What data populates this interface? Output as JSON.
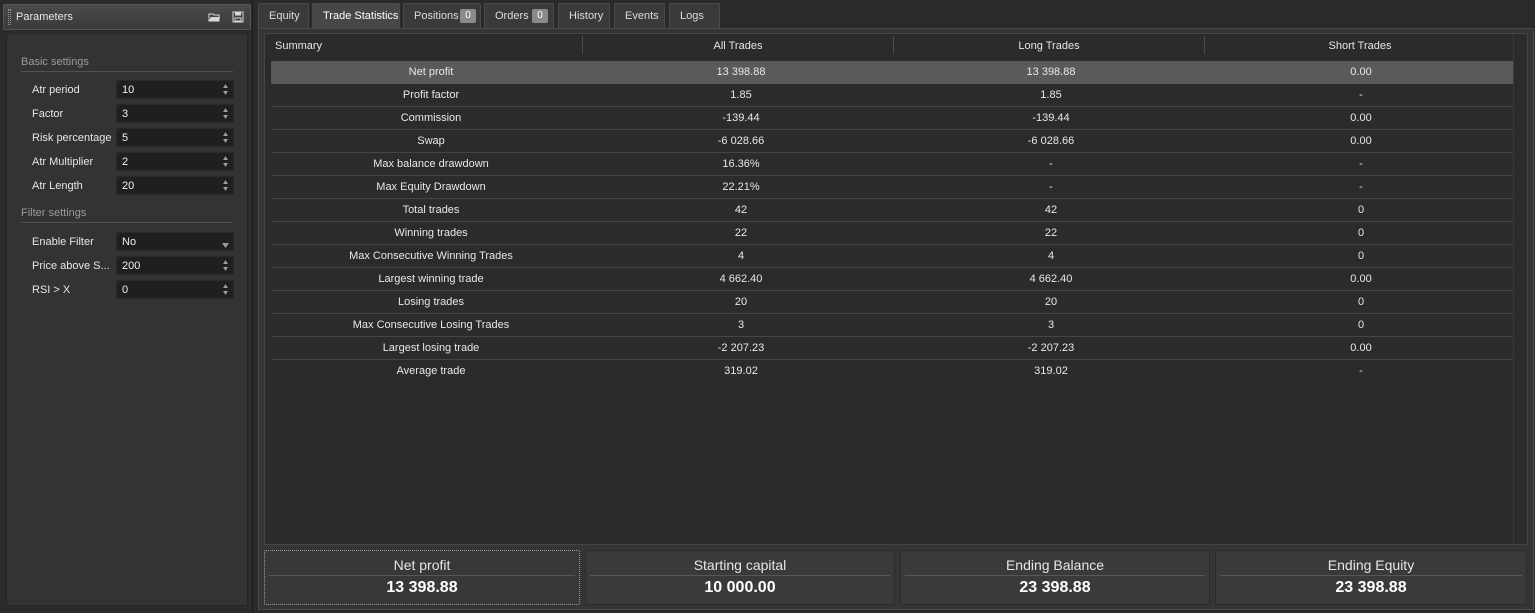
{
  "parameters_panel": {
    "title": "Parameters",
    "sections": [
      {
        "title": "Basic settings",
        "params": [
          {
            "label": "Atr period",
            "value": "10",
            "control": "spinner"
          },
          {
            "label": "Factor",
            "value": "3",
            "control": "spinner"
          },
          {
            "label": "Risk percentage",
            "value": "5",
            "control": "spinner"
          },
          {
            "label": "Atr Multiplier",
            "value": "2",
            "control": "spinner"
          },
          {
            "label": "Atr Length",
            "value": "20",
            "control": "spinner"
          }
        ]
      },
      {
        "title": "Filter settings",
        "params": [
          {
            "label": "Enable Filter",
            "value": "No",
            "control": "dropdown"
          },
          {
            "label": "Price above S...",
            "value": "200",
            "control": "spinner"
          },
          {
            "label": "RSI > X",
            "value": "0",
            "control": "spinner"
          }
        ]
      }
    ],
    "icons": [
      "folder-open-icon",
      "save-icon"
    ]
  },
  "tabs": [
    {
      "label": "Equity",
      "active": false
    },
    {
      "label": "Trade Statistics",
      "active": true
    },
    {
      "label": "Positions",
      "badge": "0",
      "active": false
    },
    {
      "label": "Orders",
      "badge": "0",
      "active": false
    },
    {
      "label": "History",
      "active": false
    },
    {
      "label": "Events",
      "active": false
    },
    {
      "label": "Logs",
      "active": false
    }
  ],
  "stats_table": {
    "columns": [
      "Summary",
      "All Trades",
      "Long Trades",
      "Short Trades"
    ],
    "rows": [
      {
        "name": "Net profit",
        "all": "13 398.88",
        "long": "13 398.88",
        "short": "0.00",
        "selected": true
      },
      {
        "name": "Profit factor",
        "all": "1.85",
        "long": "1.85",
        "short": "-"
      },
      {
        "name": "Commission",
        "all": "-139.44",
        "long": "-139.44",
        "short": "0.00"
      },
      {
        "name": "Swap",
        "all": "-6 028.66",
        "long": "-6 028.66",
        "short": "0.00"
      },
      {
        "name": "Max balance drawdown",
        "all": "16.36%",
        "long": "-",
        "short": "-"
      },
      {
        "name": "Max Equity Drawdown",
        "all": "22.21%",
        "long": "-",
        "short": "-"
      },
      {
        "name": "Total trades",
        "all": "42",
        "long": "42",
        "short": "0"
      },
      {
        "name": "Winning trades",
        "all": "22",
        "long": "22",
        "short": "0"
      },
      {
        "name": "Max Consecutive Winning Trades",
        "all": "4",
        "long": "4",
        "short": "0"
      },
      {
        "name": "Largest winning trade",
        "all": "4 662.40",
        "long": "4 662.40",
        "short": "0.00"
      },
      {
        "name": "Losing trades",
        "all": "20",
        "long": "20",
        "short": "0"
      },
      {
        "name": "Max Consecutive Losing Trades",
        "all": "3",
        "long": "3",
        "short": "0"
      },
      {
        "name": "Largest losing trade",
        "all": "-2 207.23",
        "long": "-2 207.23",
        "short": "0.00"
      },
      {
        "name": "Average trade",
        "all": "319.02",
        "long": "319.02",
        "short": "-"
      }
    ]
  },
  "summary_cards": [
    {
      "label": "Net profit",
      "value": "13 398.88"
    },
    {
      "label": "Starting capital",
      "value": "10 000.00"
    },
    {
      "label": "Ending Balance",
      "value": "23 398.88"
    },
    {
      "label": "Ending Equity",
      "value": "23 398.88"
    }
  ]
}
